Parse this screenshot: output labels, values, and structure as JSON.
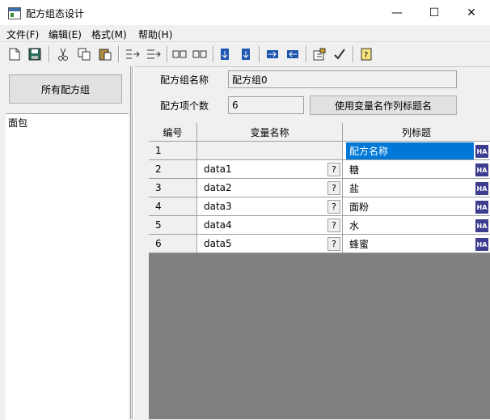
{
  "window": {
    "title": "配方组态设计",
    "min": "—",
    "max": "☐",
    "close": "✕"
  },
  "menu": [
    "文件(F)",
    "编辑(E)",
    "格式(M)",
    "帮助(H)"
  ],
  "toolbar": {
    "icons": [
      "new-file-icon",
      "save-icon",
      "cut-icon",
      "copy-icon",
      "paste-icon",
      "insert-column-icon",
      "append-column-icon",
      "insert-row-icon",
      "delete-row-icon",
      "move-up-icon",
      "move-down-icon",
      "move-right-icon",
      "move-left-icon",
      "properties-icon",
      "check-icon",
      "help-icon"
    ]
  },
  "left": {
    "all_groups_label": "所有配方组",
    "groups": [
      "面包"
    ]
  },
  "form": {
    "group_name_label": "配方组名称",
    "group_name_value": "配方组0",
    "item_count_label": "配方项个数",
    "item_count_value": "6",
    "use_var_as_header_label": "使用变量名作列标题名"
  },
  "grid": {
    "headers": [
      "编号",
      "变量名称",
      "列标题"
    ],
    "rows": [
      {
        "no": "1",
        "var": "",
        "title": "配方名称",
        "selected": true
      },
      {
        "no": "2",
        "var": "data1",
        "title": "糖"
      },
      {
        "no": "3",
        "var": "data2",
        "title": "盐"
      },
      {
        "no": "4",
        "var": "data3",
        "title": "面粉"
      },
      {
        "no": "5",
        "var": "data4",
        "title": "水"
      },
      {
        "no": "6",
        "var": "data5",
        "title": "蜂蜜"
      }
    ],
    "browse_label": "?",
    "colors": {
      "selection": "#0078d7",
      "empty_area": "#808080"
    }
  }
}
